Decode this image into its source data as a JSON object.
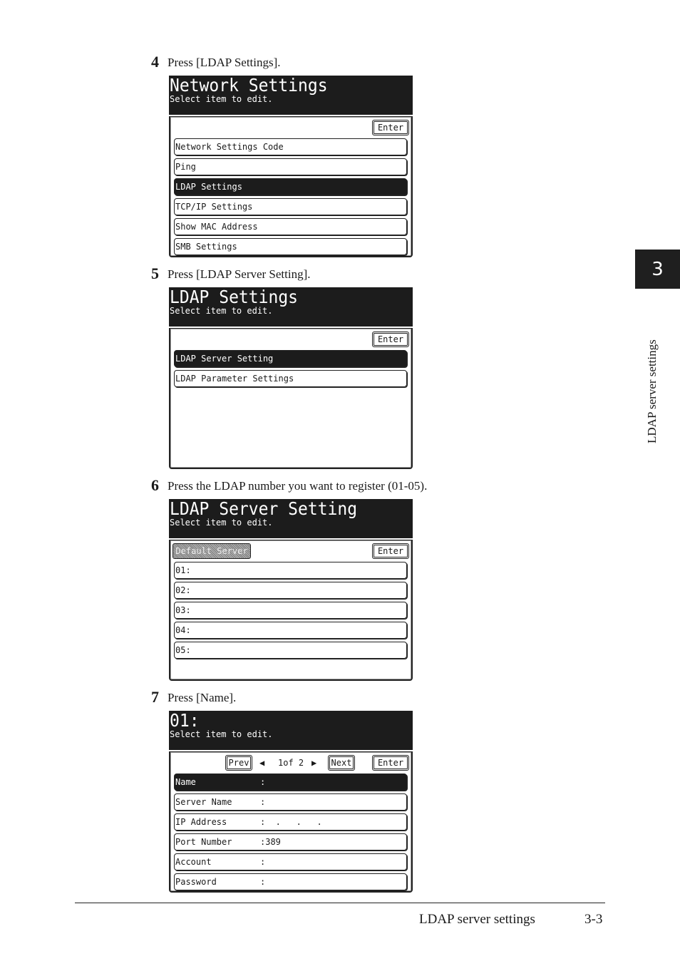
{
  "steps": [
    {
      "num": "4",
      "text": "Press [LDAP Settings]."
    },
    {
      "num": "5",
      "text": "Press [LDAP Server Setting]."
    },
    {
      "num": "6",
      "text": "Press the LDAP number you want to register (01-05)."
    },
    {
      "num": "7",
      "text": "Press [Name]."
    }
  ],
  "screens": {
    "network": {
      "title": "Network Settings",
      "subtitle": "Select item to edit.",
      "enter": "Enter",
      "items": [
        "Network Settings Code",
        "Ping",
        "LDAP Settings",
        "TCP/IP Settings",
        "Show MAC Address",
        "SMB Settings"
      ],
      "selected_index": 2
    },
    "ldap": {
      "title": "LDAP Settings",
      "subtitle": "Select item to edit.",
      "enter": "Enter",
      "items": [
        "LDAP Server Setting",
        "LDAP Parameter Settings"
      ],
      "selected_index": 0
    },
    "server": {
      "title": "LDAP Server Setting",
      "subtitle": "Select item to edit.",
      "enter": "Enter",
      "default_server": "Default Server",
      "items": [
        "01:",
        "02:",
        "03:",
        "04:",
        "05:"
      ]
    },
    "entry": {
      "title": "01:",
      "subtitle": "Select item to edit.",
      "enter": "Enter",
      "prev": "Prev",
      "next": "Next",
      "page_indicator": "1of  2",
      "page_current": 1,
      "page_total": 2,
      "fields": [
        {
          "label": "Name",
          "value": ":"
        },
        {
          "label": "Server Name",
          "value": ":"
        },
        {
          "label": "IP Address",
          "value": ":  .   .   ."
        },
        {
          "label": "Port Number",
          "value": ":389"
        },
        {
          "label": "Account",
          "value": ":"
        },
        {
          "label": "Password",
          "value": ":"
        }
      ],
      "selected_index": 0
    }
  },
  "side_tab": {
    "chapter": "3",
    "label": "LDAP server settings"
  },
  "footer": {
    "section": "LDAP server settings",
    "page": "3-3"
  }
}
